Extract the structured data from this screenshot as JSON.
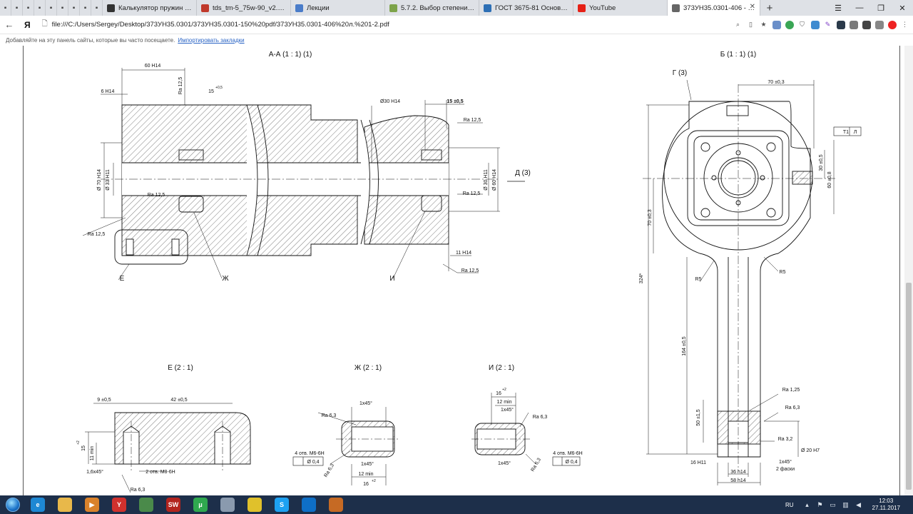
{
  "tabs": [
    {
      "title": "Калькулятор пружин сжат",
      "color": "#333333",
      "active": false
    },
    {
      "title": "tds_tm-5_75w-90_v2.2_180",
      "color": "#c0392b",
      "active": false
    },
    {
      "title": "Лекции",
      "color": "#4a7cc9",
      "active": false
    },
    {
      "title": "5.7.2. Выбор степени точнс",
      "color": "#7da34a",
      "active": false
    },
    {
      "title": "ГОСТ 3675-81 Основные н",
      "color": "#2d6fb5",
      "active": false
    },
    {
      "title": "YouTube",
      "color": "#e62117",
      "active": false
    },
    {
      "title": "373УН35.0301-406 - Лис",
      "color": "#666666",
      "active": true
    }
  ],
  "pinned_icons": [
    "settings-icon",
    "extension-icon",
    "extension-icon",
    "extension-icon",
    "extension-icon",
    "extension-icon",
    "paypal-icon",
    "extension-icon",
    "extension-icon"
  ],
  "address": {
    "back": "←",
    "yandex": "Я",
    "url": "file:///C:/Users/Sergey/Desktop/373УН35.0301/373УН35.0301-150%20pdf/373УН35.0301-406%20л.%201-2.pdf"
  },
  "bookmarks": {
    "hint": "Добавляйте на эту панель сайты, которые вы часто посещаете.",
    "import_link": "Импортировать закладки"
  },
  "drawing": {
    "view_aa": "А-А (1 : 1) (1)",
    "view_b": "Б (1 : 1) (1)",
    "view_e": "Е (2 : 1)",
    "view_zh": "Ж (2 : 1)",
    "view_i": "И (2 : 1)",
    "label_g": "Г (3)",
    "label_d": "Д (3)",
    "label_e": "Е",
    "label_zh": "Ж",
    "label_i": "И",
    "dims_aa": [
      "60 H14",
      "6 H14",
      "Ra 12,5",
      "15",
      "+0,5",
      "Ø30 H14",
      "15 ±0,5",
      "Ra 12,5",
      "Ø 70 H14",
      "Ø 33 H11",
      "Ra 12,5",
      "Ø 30 H11",
      "Ø 60 H14",
      "Ra 12,5",
      "Ra 12,5",
      "11 H14",
      "Ra 12,5"
    ],
    "dims_b": [
      "70 ±0,3",
      "30 ±0,5",
      "60 ±0,8",
      "T1",
      "Л",
      "70 ±0,3",
      "R5",
      "R5",
      "324*",
      "164 ±0,5",
      "Ra 1,25",
      "Ra 6,3",
      "50 ±1,5",
      "Ra 3,2",
      "Ø 20 H7",
      "16 H11",
      "36 h14",
      "58 h14",
      "1x45°",
      "2 фаски"
    ],
    "dims_e": [
      "9 ±0,5",
      "42 ±0,5",
      "15",
      "+2",
      "11 min",
      "1,6x45°",
      "2 отв. M8-6H",
      "Ra 6,3"
    ],
    "dims_zh": [
      "1x45°",
      "Ra 6,3",
      "4 отв. M6-6H",
      "Ø 0,4",
      "Ra 6,3",
      "1x45°",
      "12 min",
      "16",
      "+2"
    ],
    "dims_i": [
      "16",
      "+2",
      "12 min",
      "1x45°",
      "Ra 6,3",
      "4 отв. M6-6H",
      "Ø 0,4",
      "1x45°",
      "Ra 6,3"
    ]
  },
  "taskbar": {
    "apps": [
      {
        "name": "ie-icon",
        "label": "e",
        "color": "#1e88d4"
      },
      {
        "name": "explorer-icon",
        "label": "",
        "color": "#e8b84a"
      },
      {
        "name": "media-icon",
        "label": "▶",
        "color": "#d9822b"
      },
      {
        "name": "yandex-browser-icon",
        "label": "Y",
        "color": "#d0312d"
      },
      {
        "name": "network-icon",
        "label": "",
        "color": "#4a8a4a"
      },
      {
        "name": "solidworks-icon",
        "label": "SW",
        "color": "#b2241e"
      },
      {
        "name": "utorrent-icon",
        "label": "μ",
        "color": "#2fa84f"
      },
      {
        "name": "file-icon",
        "label": "",
        "color": "#8a9aae"
      },
      {
        "name": "browser-icon",
        "label": "",
        "color": "#e0c12b"
      },
      {
        "name": "skype-icon",
        "label": "S",
        "color": "#1da1f2"
      },
      {
        "name": "teamviewer-icon",
        "label": "",
        "color": "#0e6fc7"
      },
      {
        "name": "torrent-icon",
        "label": "",
        "color": "#c66a24"
      }
    ],
    "lang": "RU",
    "time": "12:03",
    "date": "27.11.2017"
  }
}
